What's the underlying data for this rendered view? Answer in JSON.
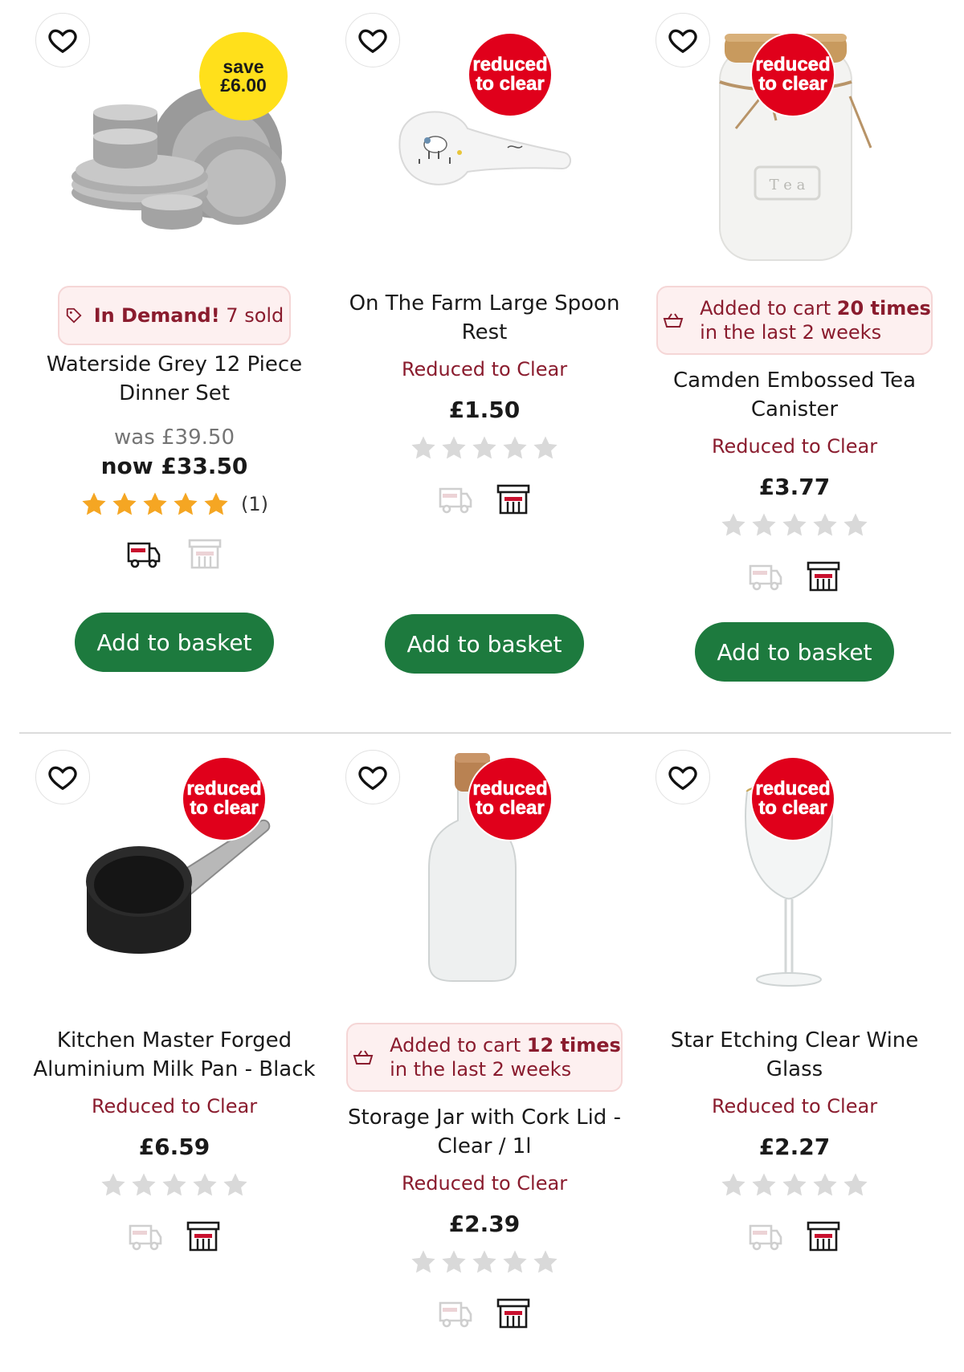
{
  "colors": {
    "accent_green": "#1d7a3e",
    "reduced_red": "#e0001b",
    "label_maroon": "#8a1c2e",
    "save_yellow": "#ffe01b",
    "star_gold": "#f5a623",
    "star_grey": "#d9d9d9"
  },
  "icons": {
    "favourite": "heart-outline-icon",
    "delivery": "delivery-van-icon",
    "store": "store-icon",
    "demand": "tag-icon",
    "cart": "basket-icon"
  },
  "products": [
    {
      "badge": {
        "type": "save",
        "line1": "save",
        "line2": "£6.00"
      },
      "pill": {
        "kind": "demand",
        "strong": "In Demand!",
        "rest": " 7 sold"
      },
      "title": "Waterside Grey 12 Piece Dinner Set",
      "was_price": "was £39.50",
      "now_price": "now £33.50",
      "rating": 5,
      "review_count": "(1)",
      "delivery_available": true,
      "store_available": false,
      "button": "Add to basket"
    },
    {
      "badge": {
        "type": "reduced",
        "line1": "reduced",
        "line2": "to clear"
      },
      "title": "On The Farm Large Spoon Rest",
      "status": "Reduced to Clear",
      "price": "£1.50",
      "rating": 0,
      "delivery_available": false,
      "store_available": true,
      "button": "Add to basket"
    },
    {
      "badge": {
        "type": "reduced",
        "line1": "reduced",
        "line2": "to clear"
      },
      "pill": {
        "kind": "cart",
        "pre": "Added to cart ",
        "strong": "20 times",
        "line2": "in the last 2 weeks"
      },
      "title": "Camden Embossed Tea Canister",
      "status": "Reduced to Clear",
      "price": "£3.77",
      "rating": 0,
      "delivery_available": false,
      "store_available": true,
      "button": "Add to basket"
    },
    {
      "badge": {
        "type": "reduced",
        "line1": "reduced",
        "line2": "to clear"
      },
      "title": "Kitchen Master Forged Aluminium Milk Pan - Black",
      "status": "Reduced to Clear",
      "price": "£6.59",
      "rating": 0,
      "delivery_available": false,
      "store_available": true
    },
    {
      "badge": {
        "type": "reduced",
        "line1": "reduced",
        "line2": "to clear"
      },
      "pill": {
        "kind": "cart",
        "pre": "Added to cart ",
        "strong": "12 times",
        "line2": "in the last 2 weeks"
      },
      "title": "Storage Jar with Cork Lid - Clear / 1l",
      "status": "Reduced to Clear",
      "price": "£2.39",
      "rating": 0,
      "delivery_available": false,
      "store_available": true
    },
    {
      "badge": {
        "type": "reduced",
        "line1": "reduced",
        "line2": "to clear"
      },
      "title": "Star Etching Clear Wine Glass",
      "status": "Reduced to Clear",
      "price": "£2.27",
      "rating": 0,
      "delivery_available": false,
      "store_available": true
    }
  ]
}
